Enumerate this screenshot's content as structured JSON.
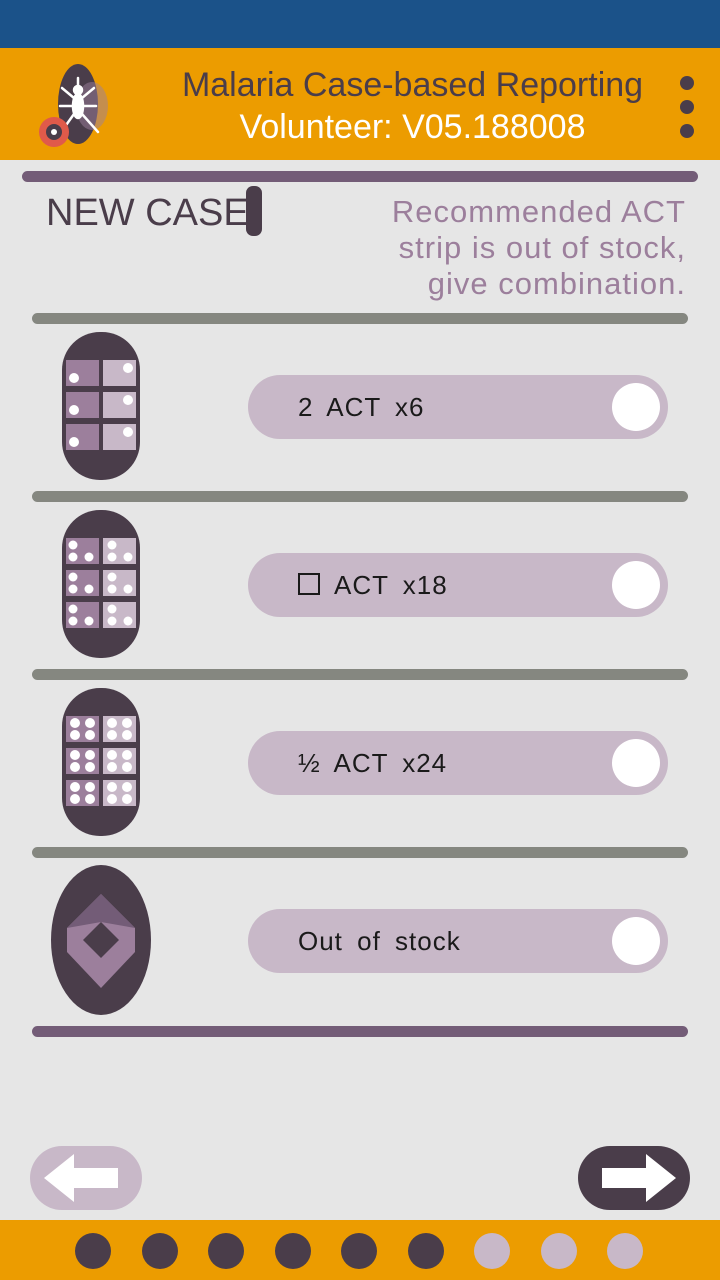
{
  "header": {
    "title": "Malaria Case-based Reporting",
    "volunteer": "Volunteer: V05.188008",
    "logo_icon": "mosquito-icon",
    "menu_icon": "more-vert-icon"
  },
  "page": {
    "heading": "NEW CASE",
    "notice": "Recommended ACT strip is out of stock, give combination."
  },
  "options": [
    {
      "label": "2  ACT  x6",
      "icon": "act-strip-6-icon",
      "toggle_on": false
    },
    {
      "label": "ACT  x18",
      "icon": "act-strip-18-icon",
      "toggle_on": false,
      "checkbox": true
    },
    {
      "label": "½  ACT  x24",
      "icon": "act-strip-24-icon",
      "toggle_on": false
    },
    {
      "label": "Out  of  stock",
      "icon": "out-of-stock-icon",
      "toggle_on": false
    }
  ],
  "navigation": {
    "back_icon": "arrow-left-icon",
    "next_icon": "arrow-right-icon"
  },
  "progress": {
    "total_steps": 9,
    "completed_steps": 6
  },
  "colors": {
    "status_bar": "#1b5289",
    "header": "#ec9c00",
    "dark": "#4a3d4a",
    "pill": "#c8b8c8",
    "notice_text": "#9c7f9c"
  }
}
